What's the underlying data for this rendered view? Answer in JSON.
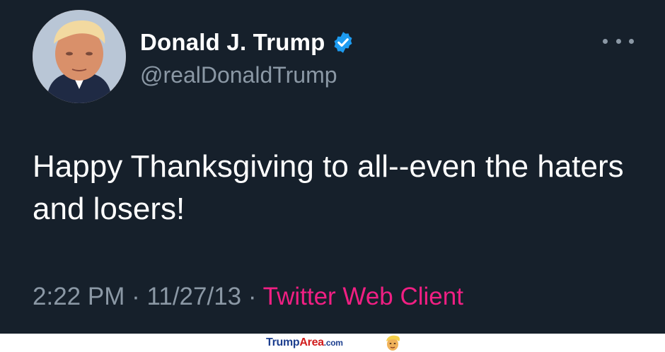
{
  "tweet": {
    "author_name": "Donald J. Trump",
    "handle": "@realDonaldTrump",
    "text": "Happy Thanksgiving to all--even the haters and losers!",
    "time": "2:22 PM",
    "separator": "·",
    "date": "11/27/13",
    "client": "Twitter Web Client",
    "more_icon": "more-horizontal-icon",
    "verified_icon": "verified-badge-icon"
  },
  "watermark": {
    "part1": "Trump",
    "part2": "Area",
    "part3": ".com"
  },
  "colors": {
    "background": "#16202b",
    "text": "#ffffff",
    "secondary": "#8b98a5",
    "client_link": "#f01f83",
    "verified": "#1d9bf0"
  }
}
